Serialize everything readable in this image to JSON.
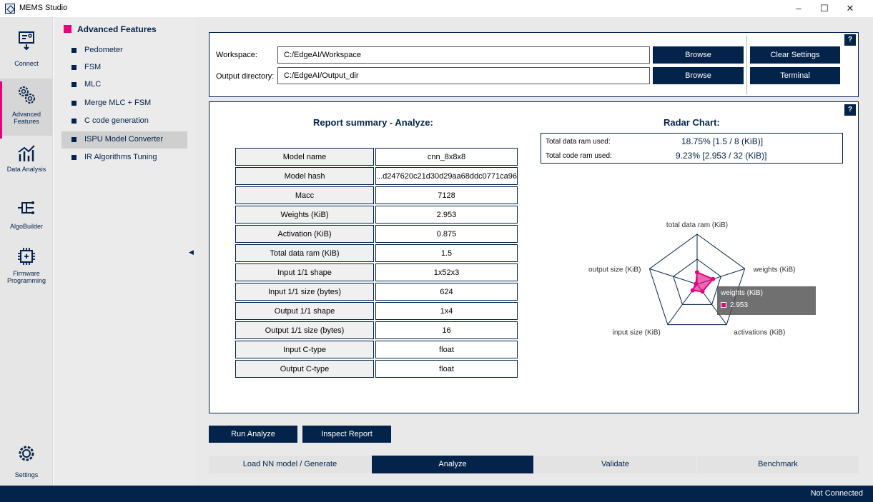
{
  "window": {
    "title": "MEMS Studio",
    "controls": {
      "minimize": "–",
      "maximize": "☐",
      "close": "✕"
    }
  },
  "sidebar": {
    "items": [
      {
        "label": "Connect",
        "icon": "connect-icon"
      },
      {
        "label": "Advanced Features",
        "icon": "gears-icon",
        "selected": true
      },
      {
        "label": "Data Analysis",
        "icon": "chart-icon"
      },
      {
        "label": "AlgoBuilder",
        "icon": "algobuilder-icon"
      },
      {
        "label": "Firmware Programming",
        "icon": "chip-icon"
      }
    ],
    "settings": {
      "label": "Settings",
      "icon": "settings-gear-icon"
    }
  },
  "features": {
    "heading": "Advanced Features",
    "items": [
      "Pedometer",
      "FSM",
      "MLC",
      "Merge MLC + FSM",
      "C code generation",
      "ISPU Model Converter",
      "IR Algorithms Tuning"
    ],
    "selected_index": 5
  },
  "paths": {
    "workspace_label": "Workspace:",
    "workspace_value": "C:/EdgeAI/Workspace",
    "output_label": "Output directory:",
    "output_value": "C:/EdgeAI/Output_dir",
    "browse_label": "Browse",
    "clear_settings_label": "Clear Settings",
    "terminal_label": "Terminal",
    "help": "?"
  },
  "report": {
    "title": "Report summary - Analyze:",
    "rows": [
      {
        "key": "Model name",
        "value": "cnn_8x8x8"
      },
      {
        "key": "Model hash",
        "value": "...d247620c21d30d29aa68ddc0771ca96"
      },
      {
        "key": "Macc",
        "value": "7128"
      },
      {
        "key": "Weights (KiB)",
        "value": "2.953"
      },
      {
        "key": "Activation (KiB)",
        "value": "0.875"
      },
      {
        "key": "Total data ram (KiB)",
        "value": "1.5"
      },
      {
        "key": "Input 1/1 shape",
        "value": "1x52x3"
      },
      {
        "key": "Input 1/1 size (bytes)",
        "value": "624"
      },
      {
        "key": "Output 1/1 shape",
        "value": "1x4"
      },
      {
        "key": "Output 1/1 size (bytes)",
        "value": "16"
      },
      {
        "key": "Input C-type",
        "value": "float"
      },
      {
        "key": "Output C-type",
        "value": "float"
      }
    ]
  },
  "radar": {
    "title": "Radar Chart:",
    "help": "?",
    "data_ram_label": "Total data ram used:",
    "data_ram_value": "18.75%  [1.5 / 8 (KiB)]",
    "code_ram_label": "Total code ram used:",
    "code_ram_value": "9.23%  [2.953 / 32 (KiB)]",
    "axes": [
      "total data ram (KiB)",
      "weights (KiB)",
      "activations (KiB)",
      "input size (KiB)",
      "output size (KiB)"
    ],
    "tooltip_title": "weights (KiB)",
    "tooltip_value": "2.953",
    "series_color": "#e6007e"
  },
  "chart_data": {
    "type": "radar",
    "axes": [
      "total data ram (KiB)",
      "weights (KiB)",
      "activations (KiB)",
      "input size (KiB)",
      "output size (KiB)"
    ],
    "series": [
      {
        "values": [
          1.5,
          2.953,
          0.875,
          0.609,
          0.016
        ]
      }
    ],
    "grid_levels": 2,
    "max": 32
  },
  "actions": {
    "run_analyze": "Run Analyze",
    "inspect_report": "Inspect Report"
  },
  "tabs": [
    {
      "label": "Load NN model / Generate"
    },
    {
      "label": "Analyze",
      "active": true
    },
    {
      "label": "Validate"
    },
    {
      "label": "Benchmark"
    }
  ],
  "status": {
    "text": "Not Connected"
  },
  "colors": {
    "navy": "#03234b",
    "accent": "#e6007e"
  }
}
